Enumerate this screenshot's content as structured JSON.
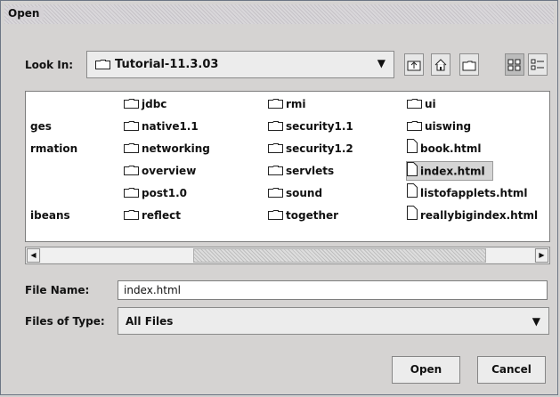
{
  "dialog": {
    "title": "Open"
  },
  "lookin": {
    "label": "Look In:",
    "value": "Tutorial-11.3.03"
  },
  "toolbar": [
    {
      "name": "up-folder-button",
      "icon": "up-folder-icon"
    },
    {
      "name": "home-button",
      "icon": "home-icon"
    },
    {
      "name": "new-folder-button",
      "icon": "new-folder-icon"
    },
    {
      "name": "list-view-button",
      "icon": "list-view-icon",
      "active": true
    },
    {
      "name": "details-view-button",
      "icon": "details-view-icon"
    }
  ],
  "files": {
    "col0": [
      "",
      "ges",
      "rmation",
      "",
      "",
      "ibeans"
    ],
    "col1": [
      "jdbc",
      "native1.1",
      "networking",
      "overview",
      "post1.0",
      "reflect"
    ],
    "col2": [
      "rmi",
      "security1.1",
      "security1.2",
      "servlets",
      "sound",
      "together"
    ],
    "col3": [
      "ui",
      "uiswing",
      "book.html",
      "index.html",
      "listofapplets.html",
      "reallybigindex.html"
    ],
    "col3_types": [
      "folder",
      "folder",
      "file",
      "file",
      "file",
      "file"
    ],
    "selected": "index.html"
  },
  "filename": {
    "label": "File Name:",
    "value": "index.html"
  },
  "filetype": {
    "label": "Files of Type:",
    "value": "All Files"
  },
  "buttons": {
    "open": "Open",
    "cancel": "Cancel"
  },
  "colors": {
    "background": "#d5d3d2",
    "list_bg": "#ffffff",
    "selection": "#d5d5d5"
  }
}
